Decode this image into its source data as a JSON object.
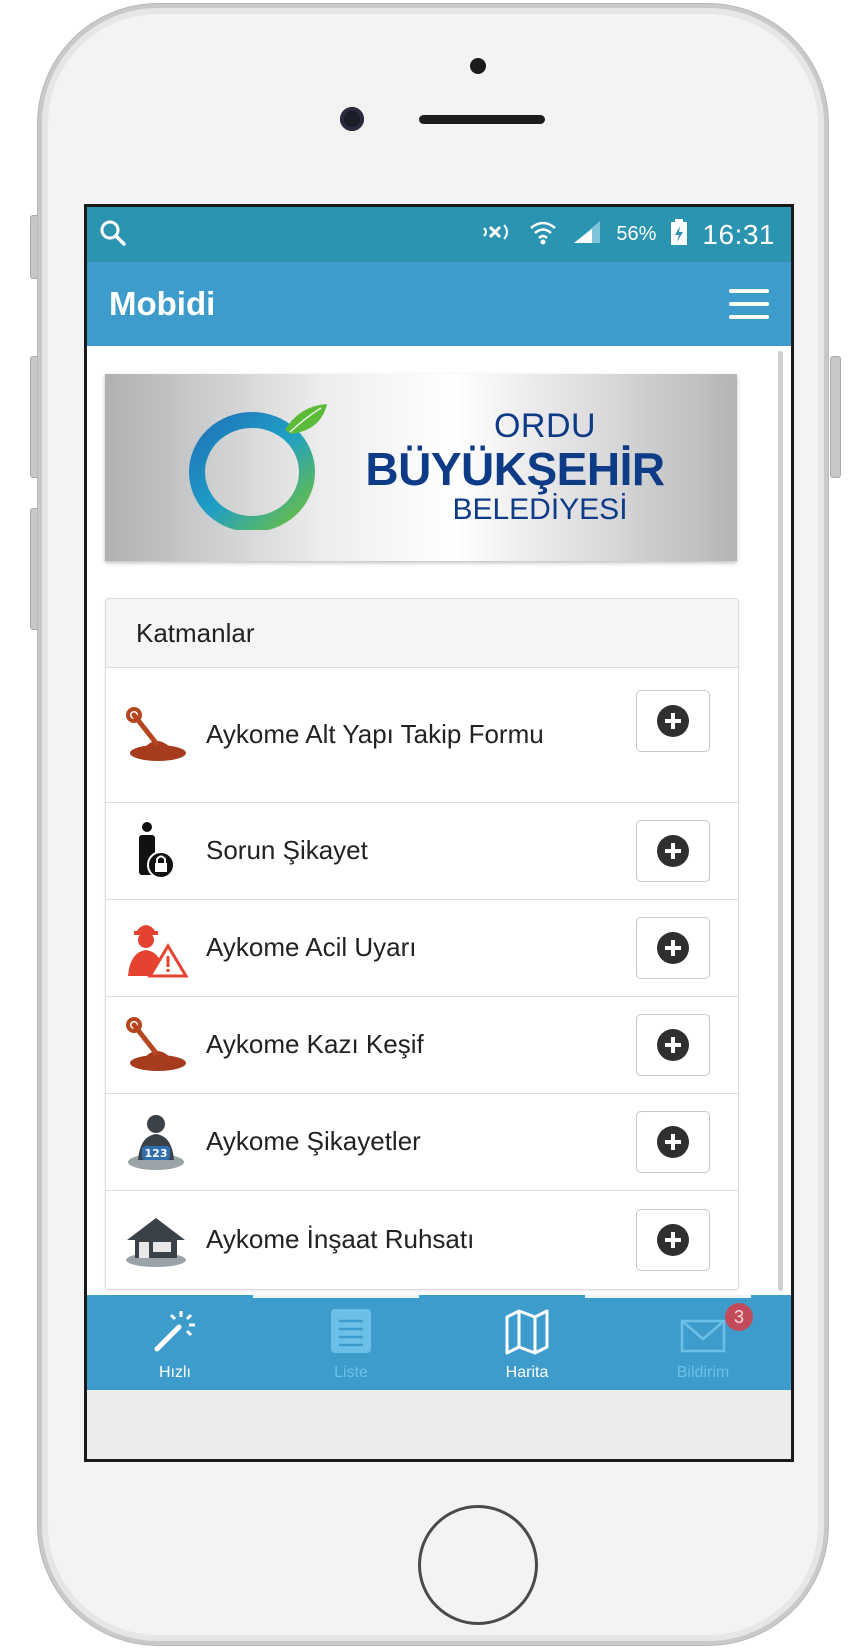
{
  "status_bar": {
    "battery_percent": "56%",
    "time": "16:31",
    "icons": [
      "search-icon",
      "mute-icon",
      "wifi-icon",
      "signal-icon",
      "battery-charging-icon"
    ]
  },
  "app_bar": {
    "title": "Mobidi",
    "menu_icon": "hamburger-menu-icon"
  },
  "banner": {
    "line1": "ORDU",
    "line2": "BÜYÜKŞEHİR",
    "line3": "BELEDİYESİ",
    "colors": {
      "text": "#0d3b86",
      "ring_green": "#5dbb3a",
      "ring_blue": "#1f72b8"
    }
  },
  "layers_panel": {
    "heading": "Katmanlar",
    "items": [
      {
        "label": "Aykome Alt Yapı Takip Formu",
        "icon": "excavation-icon"
      },
      {
        "label": "Sorun Şikayet",
        "icon": "person-lock-icon"
      },
      {
        "label": "Aykome Acil Uyarı",
        "icon": "worker-warning-icon"
      },
      {
        "label": "Aykome Kazı Keşif",
        "icon": "excavation-icon"
      },
      {
        "label": "Aykome Şikayetler",
        "icon": "person-number-icon"
      },
      {
        "label": "Aykome İnşaat Ruhsatı",
        "icon": "house-icon"
      }
    ]
  },
  "tab_bar": {
    "tabs": [
      {
        "label": "Hızlı",
        "icon": "magic-wand-icon"
      },
      {
        "label": "Liste",
        "icon": "list-icon"
      },
      {
        "label": "Harita",
        "icon": "map-icon"
      },
      {
        "label": "Bildirim",
        "icon": "envelope-icon",
        "badge": "3"
      }
    ]
  },
  "colors": {
    "status_bar": "#2b94b1",
    "app_bar": "#3e9ccc",
    "tab_inactive": "#6cc0e8"
  }
}
